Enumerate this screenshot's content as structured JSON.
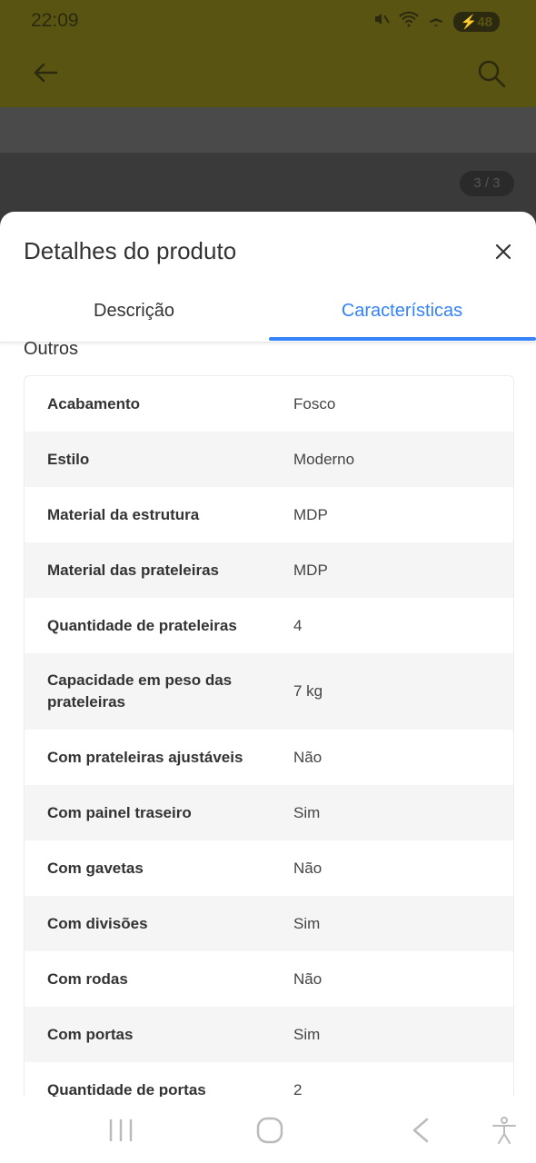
{
  "status_bar": {
    "time": "22:09",
    "battery": "48"
  },
  "background": {
    "image_counter": "3 / 3"
  },
  "sheet": {
    "title": "Detalhes do produto",
    "tabs": [
      {
        "label": "Descrição",
        "active": false
      },
      {
        "label": "Características",
        "active": true
      }
    ],
    "section_title": "Outros",
    "specs": [
      {
        "label": "Acabamento",
        "value": "Fosco"
      },
      {
        "label": "Estilo",
        "value": "Moderno"
      },
      {
        "label": "Material da estrutura",
        "value": "MDP"
      },
      {
        "label": "Material das prateleiras",
        "value": "MDP"
      },
      {
        "label": "Quantidade de prateleiras",
        "value": "4"
      },
      {
        "label": "Capacidade em peso das prateleiras",
        "value": "7 kg"
      },
      {
        "label": "Com prateleiras ajustáveis",
        "value": "Não"
      },
      {
        "label": "Com painel traseiro",
        "value": "Sim"
      },
      {
        "label": "Com gavetas",
        "value": "Não"
      },
      {
        "label": "Com divisões",
        "value": "Sim"
      },
      {
        "label": "Com rodas",
        "value": "Não"
      },
      {
        "label": "Com portas",
        "value": "Sim"
      },
      {
        "label": "Quantidade de portas",
        "value": "2"
      }
    ]
  },
  "colors": {
    "accent": "#3483fa",
    "header_dimmed": "#5a5412"
  },
  "icons": {
    "back": "back-arrow-icon",
    "search": "search-icon",
    "close": "close-icon",
    "nav_recents": "recents-icon",
    "nav_home": "home-icon",
    "nav_back": "nav-back-icon",
    "nav_accessibility": "accessibility-icon"
  }
}
